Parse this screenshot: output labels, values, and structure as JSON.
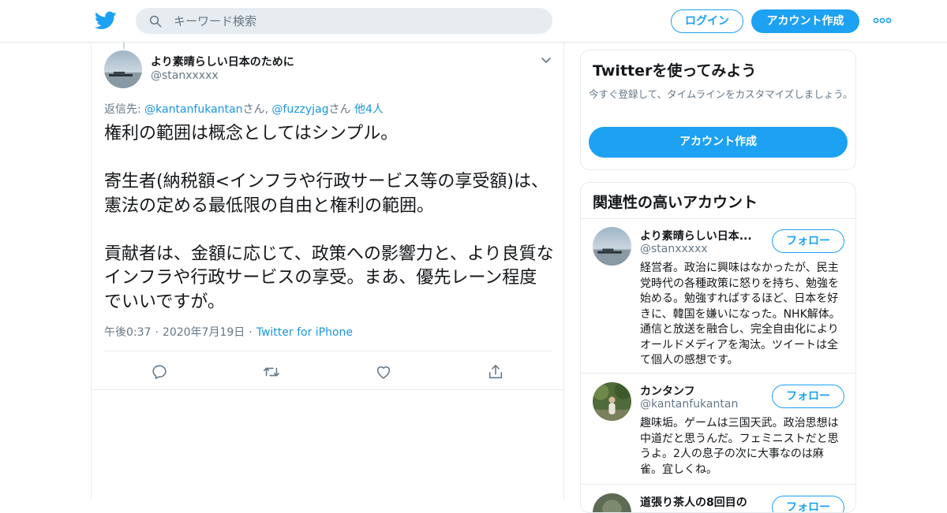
{
  "header": {
    "search_placeholder": "キーワード検索",
    "login_label": "ログイン",
    "signup_label": "アカウント作成",
    "brand_color": "#1da1f2"
  },
  "tweet": {
    "author_name": "より素晴らしい日本のために",
    "author_handle": "@stanxxxxx",
    "reply_prefix": "返信先: ",
    "reply_user1": "@kantanfukantan",
    "reply_suffix1": "さん, ",
    "reply_user2": "@fuzzyjag",
    "reply_suffix2": "さん ",
    "reply_others": "他4人",
    "text": "権利の範囲は概念としてはシンプル。\n\n寄生者(納税額<インフラや行政サービス等の享受額)は、憲法の定める最低限の自由と権利の範囲。\n\n貢献者は、金額に応じて、政策への影響力と、より良質なインフラや行政サービスの享受。まあ、優先レーン程度でいいですが。",
    "time": "午後0:37",
    "date": "2020年7月19日",
    "source": "Twitter for iPhone",
    "sep1": "·",
    "sep2": "·"
  },
  "signup_card": {
    "title": "Twitterを使ってみよう",
    "description": "今すぐ登録して、タイムラインをカスタマイズしましょう。",
    "button_label": "アカウント作成"
  },
  "related": {
    "title": "関連性の高いアカウント",
    "accounts": [
      {
        "name": "より素晴らしい日本...",
        "handle": "@stanxxxxx",
        "follow_label": "フォロー",
        "bio": "経営者。政治に興味はなかったが、民主党時代の各種政策に怒りを持ち、勉強を始める。勉強すればするほど、日本を好きに、韓国を嫌いになった。NHK解体。通信と放送を融合し、完全自由化によりオールドメディアを淘汰。ツイートは全て個人の感想です。"
      },
      {
        "name": "カンタンフ",
        "handle": "@kantanfukantan",
        "follow_label": "フォロー",
        "bio": "趣味垢。ゲームは三国天武。政治思想は中道だと思うんだ。フェミニストだと思うよ。2人の息子の次に大事なのは麻雀。宜しくね。"
      },
      {
        "name": "道張り茶人の8回目の",
        "handle": "",
        "follow_label": "フォロー",
        "bio": ""
      }
    ]
  }
}
